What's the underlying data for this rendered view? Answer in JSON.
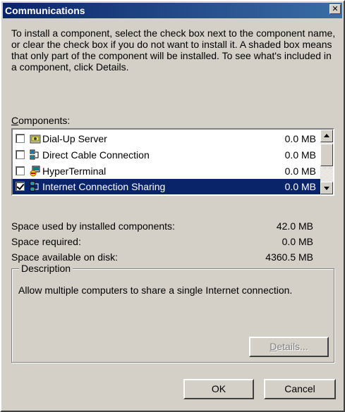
{
  "window": {
    "title": "Communications",
    "close_label": "✕"
  },
  "instructions": "To install a component, select the check box next to the component name, or clear the check box if you do not want to install it. A shaded box means that only part of the component will be installed. To see what's included in a component, click Details.",
  "components": {
    "label_mnemonic": "C",
    "label_rest": "omponents:",
    "items": [
      {
        "name": "Dial-Up Server",
        "size": "0.0 MB",
        "checked": false,
        "selected": false,
        "icon": "dial-up-server-icon"
      },
      {
        "name": "Direct Cable Connection",
        "size": "0.0 MB",
        "checked": false,
        "selected": false,
        "icon": "direct-cable-icon"
      },
      {
        "name": "HyperTerminal",
        "size": "0.0 MB",
        "checked": false,
        "selected": false,
        "icon": "hyperterminal-icon"
      },
      {
        "name": "Internet Connection Sharing",
        "size": "0.0 MB",
        "checked": true,
        "selected": true,
        "icon": "network-sharing-icon"
      }
    ]
  },
  "space": {
    "used_label": "Space used by installed components:",
    "used_value": "42.0 MB",
    "required_label": "Space required:",
    "required_value": "0.0 MB",
    "available_label": "Space available on disk:",
    "available_value": "4360.5 MB"
  },
  "description": {
    "title": "Description",
    "text": "Allow multiple computers to share a single Internet connection."
  },
  "buttons": {
    "details_mnemonic": "D",
    "details_rest": "etails...",
    "ok": "OK",
    "cancel": "Cancel"
  },
  "colors": {
    "titlebar": "#0a246a",
    "face": "#d4d0c8",
    "selection": "#0a246a"
  }
}
